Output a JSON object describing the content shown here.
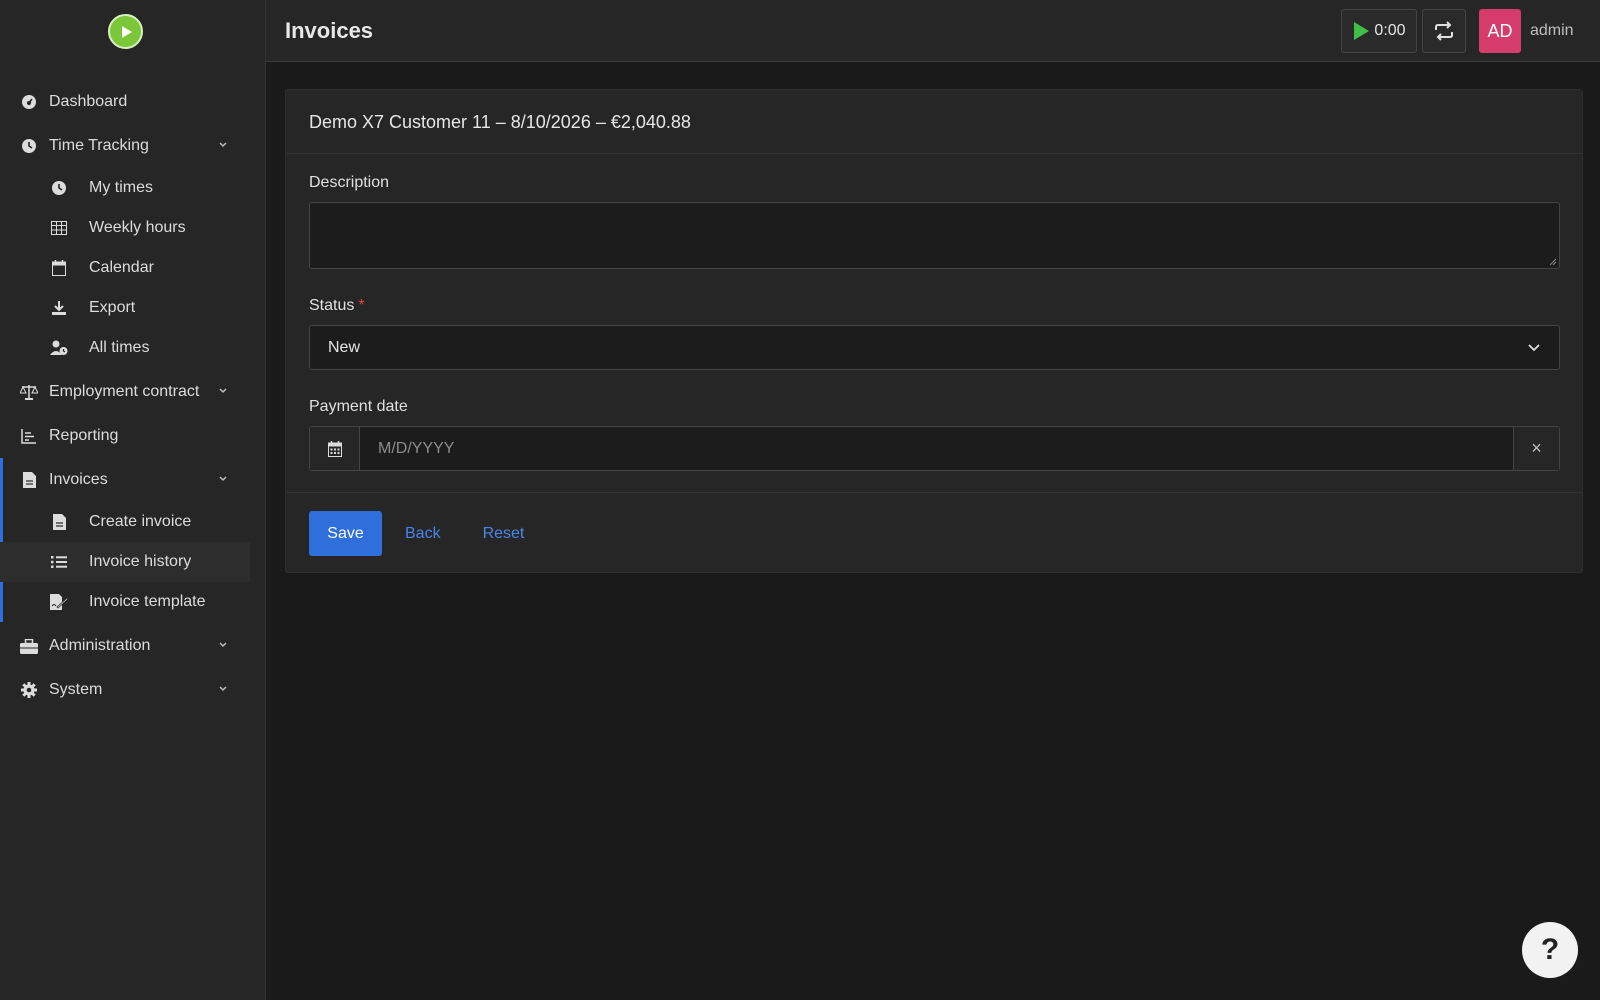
{
  "sidebar": {
    "items": [
      {
        "label": "Dashboard",
        "icon": "dashboard-icon"
      },
      {
        "label": "Time Tracking",
        "icon": "clock-icon",
        "expanded": true,
        "children": [
          {
            "label": "My times",
            "icon": "clock-icon"
          },
          {
            "label": "Weekly hours",
            "icon": "table-icon"
          },
          {
            "label": "Calendar",
            "icon": "calendar-icon"
          },
          {
            "label": "Export",
            "icon": "download-icon"
          },
          {
            "label": "All times",
            "icon": "user-clock-icon"
          }
        ]
      },
      {
        "label": "Employment contract",
        "icon": "balance-scale-icon"
      },
      {
        "label": "Reporting",
        "icon": "chart-icon"
      },
      {
        "label": "Invoices",
        "icon": "invoice-icon",
        "expanded": true,
        "children": [
          {
            "label": "Create invoice",
            "icon": "invoice-icon"
          },
          {
            "label": "Invoice history",
            "icon": "list-icon",
            "selected": true
          },
          {
            "label": "Invoice template",
            "icon": "file-signature-icon"
          }
        ]
      },
      {
        "label": "Administration",
        "icon": "toolbox-icon"
      },
      {
        "label": "System",
        "icon": "gear-icon"
      }
    ]
  },
  "header": {
    "title": "Invoices",
    "timer": "0:00",
    "avatar_initials": "AD",
    "username": "admin"
  },
  "card": {
    "title": "Demo X7 Customer 11 – 8/10/2026 – €2,040.88",
    "description_label": "Description",
    "description_value": "",
    "status_label": "Status",
    "status_required_mark": "*",
    "status_value": "New",
    "payment_date_label": "Payment date",
    "payment_date_placeholder": "M/D/YYYY",
    "payment_date_clear": "×",
    "save_label": "Save",
    "back_label": "Back",
    "reset_label": "Reset"
  },
  "help": {
    "label": "?"
  },
  "colors": {
    "accent": "#2f6fdb",
    "avatar": "#d63c6b",
    "logo": "#7cc63a",
    "timer_play": "#3fbf4a"
  }
}
